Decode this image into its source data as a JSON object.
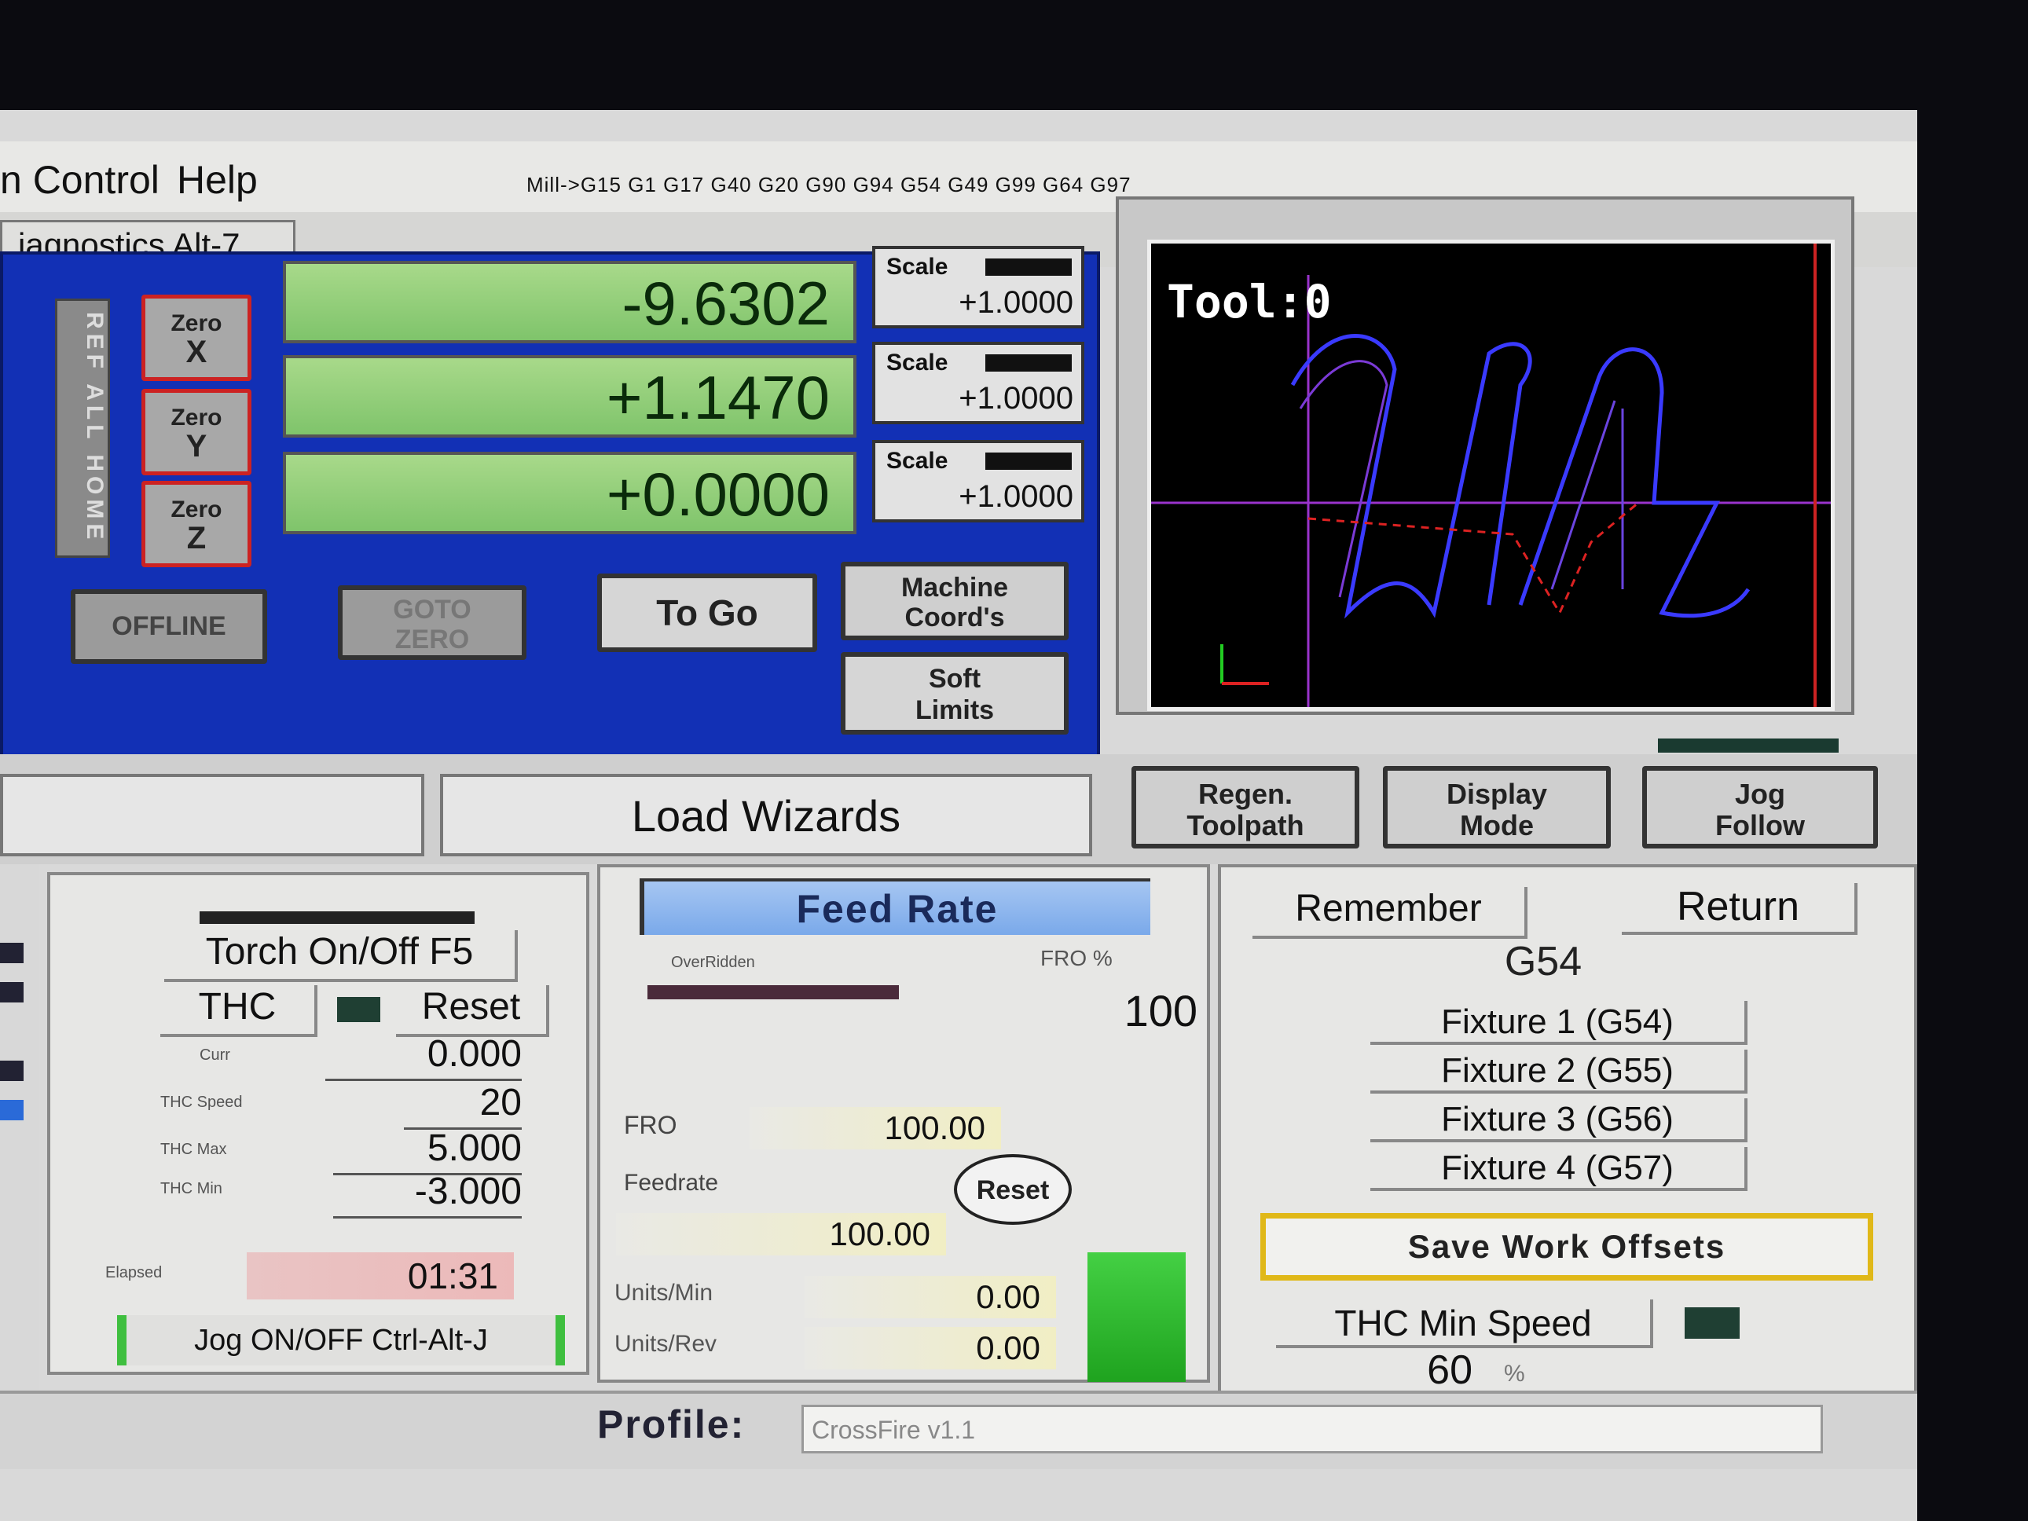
{
  "menu": {
    "items": [
      "n Control",
      "Help"
    ]
  },
  "tabs": {
    "active": "iagnostics Alt-7"
  },
  "gcode_status": "Mill->G15  G1 G17 G40 G20 G90 G94 G54 G49 G99 G64 G97",
  "dro": {
    "ref_all_home": "REF ALL HOME",
    "axes": [
      {
        "zero_label": "Zero",
        "axis": "X",
        "value": "-9.6302",
        "scale_label": "Scale",
        "scale_value": "+1.0000"
      },
      {
        "zero_label": "Zero",
        "axis": "Y",
        "value": "+1.1470",
        "scale_label": "Scale",
        "scale_value": "+1.0000"
      },
      {
        "zero_label": "Zero",
        "axis": "Z",
        "value": "+0.0000",
        "scale_label": "Scale",
        "scale_value": "+1.0000"
      }
    ],
    "offline": "OFFLINE",
    "goto_zero_1": "GOTO",
    "goto_zero_2": "ZERO",
    "to_go": "To Go",
    "machine_1": "Machine",
    "machine_2": "Coord's",
    "soft_1": "Soft",
    "soft_2": "Limits"
  },
  "toolpath": {
    "tool_label": "Tool:0"
  },
  "middle": {
    "load_wizards": "Load Wizards",
    "regen_1": "Regen.",
    "regen_2": "Toolpath",
    "display_1": "Display",
    "display_2": "Mode",
    "jog_1": "Jog",
    "jog_2": "Follow"
  },
  "plasma": {
    "torch": "Torch On/Off F5",
    "thc": "THC",
    "reset": "Reset",
    "curr_label": "Curr",
    "curr_value": "0.000",
    "speed_label": "THC Speed",
    "speed_value": "20",
    "max_label": "THC Max",
    "max_value": "5.000",
    "min_label": "THC Min",
    "min_value": "-3.000",
    "elapsed_label": "Elapsed",
    "elapsed_value": "01:31",
    "jog_toggle": "Jog ON/OFF Ctrl-Alt-J"
  },
  "feed": {
    "title": "Feed Rate",
    "overridden": "OverRidden",
    "fro_pct_label": "FRO %",
    "fro_pct_value": "100",
    "fro_label": "FRO",
    "fro_value": "100.00",
    "feedrate_label": "Feedrate",
    "feedrate_value": "100.00",
    "reset": "Reset",
    "units_min_label": "Units/Min",
    "units_min_value": "0.00",
    "units_rev_label": "Units/Rev",
    "units_rev_value": "0.00"
  },
  "offsets": {
    "remember": "Remember",
    "return": "Return",
    "current": "G54",
    "fixtures": [
      "Fixture 1 (G54)",
      "Fixture 2 (G55)",
      "Fixture 3 (G56)",
      "Fixture 4 (G57)"
    ],
    "save": "Save Work Offsets",
    "thc_min_speed": "THC Min Speed",
    "thc_min_value": "60",
    "pct": "%"
  },
  "profile": {
    "label": "Profile:",
    "value": "CrossFire v1.1"
  },
  "colors": {
    "dro_panel": "#1230b5",
    "dro_green": "#8fcf76",
    "toolpath_blue": "#3a3aff",
    "toolpath_magenta": "#cc33cc"
  }
}
